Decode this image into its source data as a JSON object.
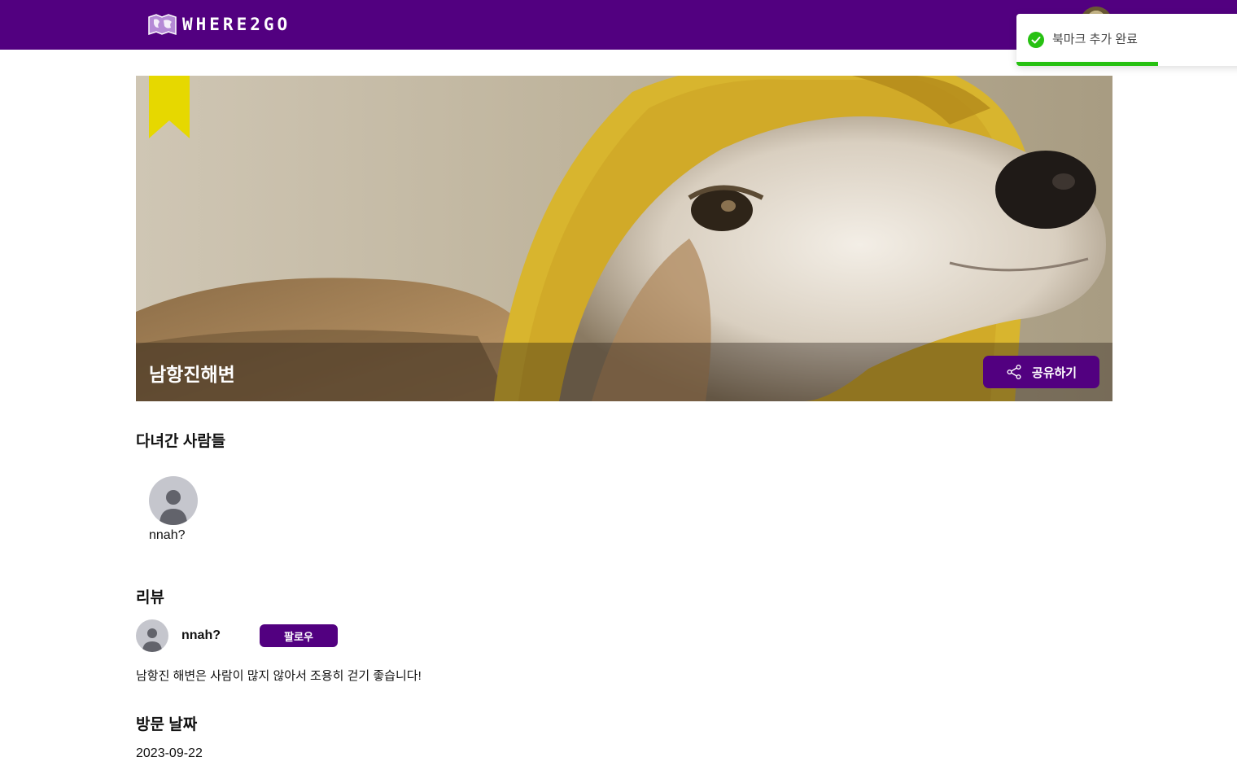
{
  "header": {
    "logo_text": "WHERE2GO"
  },
  "toast": {
    "message": "북마크 추가 완료",
    "progress_fraction": 0.6,
    "color": "#27c112"
  },
  "place": {
    "name": "남항진해변",
    "share_label": "공유하기",
    "bookmarked": true,
    "bookmark_color": "#e6d800"
  },
  "visitors": {
    "title": "다녀간 사람들",
    "people": [
      {
        "name": "nnah?"
      }
    ]
  },
  "review": {
    "title": "리뷰",
    "user": "nnah?",
    "follow_label": "팔로우",
    "text": "남항진 해변은 사람이 많지 않아서 조용히 걷기 좋습니다!"
  },
  "visit": {
    "title": "방문 날짜",
    "date": "2023-09-22"
  },
  "colors": {
    "brand": "#520080",
    "avatar_bg": "#c5c6cd"
  }
}
